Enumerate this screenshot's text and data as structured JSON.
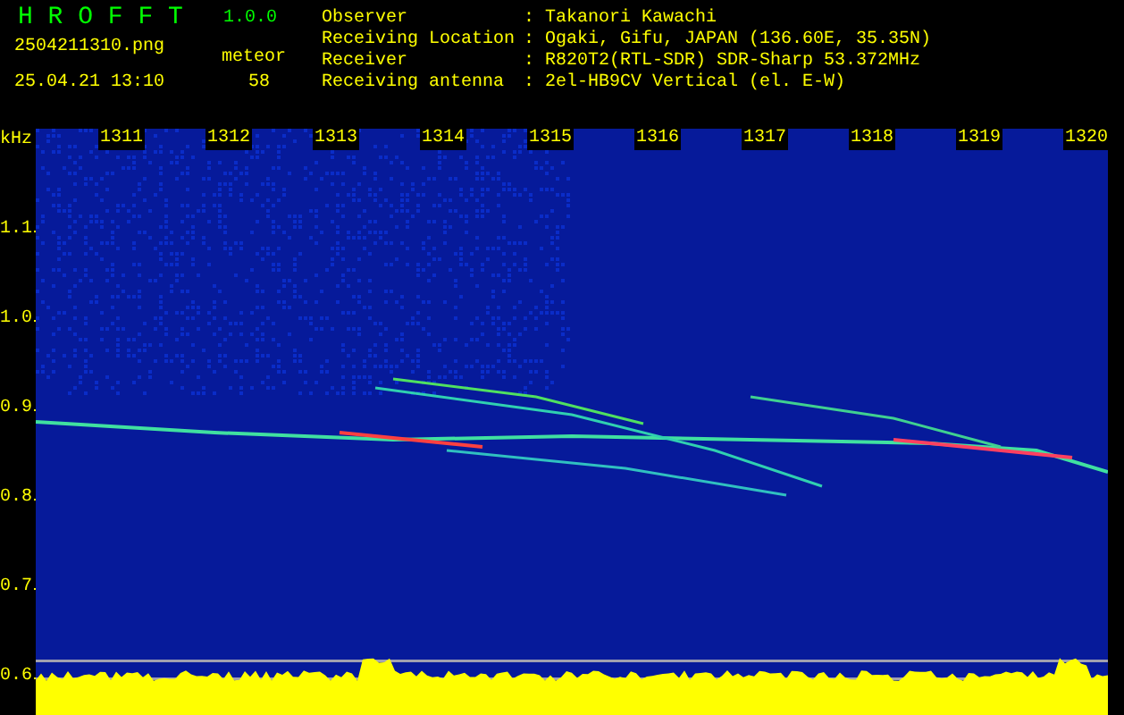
{
  "header": {
    "app_name": "H R O F F T",
    "version": "1.0.0",
    "file_name": "2504211310.png",
    "timestamp": "25.04.21 13:10",
    "count_label": "meteor",
    "count": "58"
  },
  "info": {
    "separator": ":",
    "rows": [
      {
        "label": "Observer",
        "value": "Takanori Kawachi"
      },
      {
        "label": "Receiving Location",
        "value": "Ogaki, Gifu, JAPAN (136.60E, 35.35N)"
      },
      {
        "label": "Receiver",
        "value": "R820T2(RTL-SDR) SDR-Sharp 53.372MHz"
      },
      {
        "label": "Receiving antenna",
        "value": "2el-HB9CV Vertical (el. E-W)"
      }
    ]
  },
  "spectrogram": {
    "y_unit": "kHz",
    "y_ticks": [
      "1.1",
      "1.0",
      "0.9",
      "0.8",
      "0.7",
      "0.6"
    ],
    "x_ticks": [
      "1311",
      "1312",
      "1313",
      "1314",
      "1315",
      "1316",
      "1317",
      "1318",
      "1319",
      "1320"
    ]
  }
}
